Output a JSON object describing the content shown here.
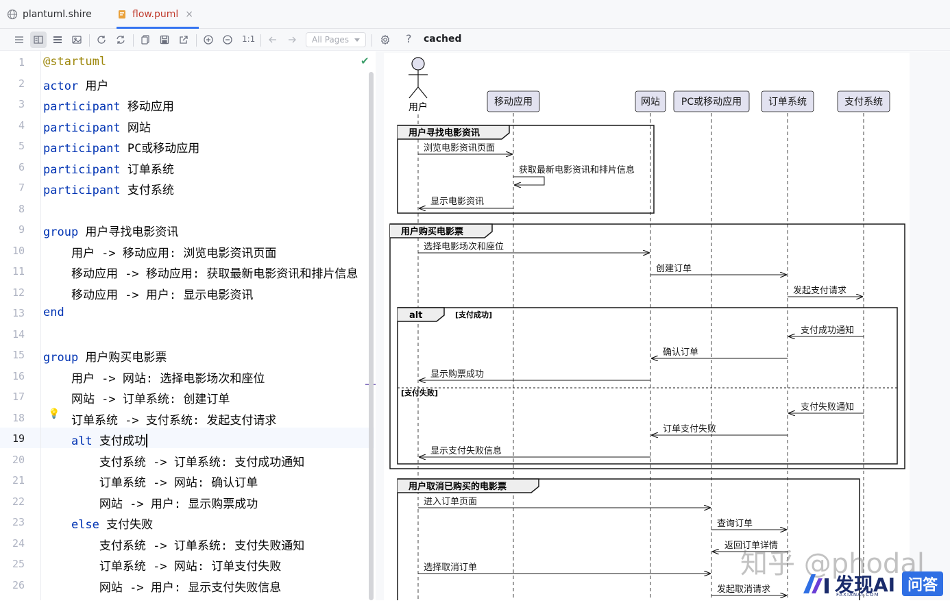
{
  "tabs": [
    {
      "label": "plantuml.shire",
      "icon": "globe-icon"
    },
    {
      "label": "flow.puml",
      "icon": "puml-file-icon",
      "close": "×"
    }
  ],
  "toolbar": {
    "zoom_label": "1:1",
    "pages_select": "All Pages",
    "help": "?",
    "status": "cached"
  },
  "editor": {
    "current_line": 19,
    "lines": [
      {
        "n": "1",
        "parts": [
          [
            "dir",
            "@startuml"
          ]
        ]
      },
      {
        "n": "2",
        "parts": [
          [
            "kw",
            "actor"
          ],
          [
            "t",
            " 用户"
          ]
        ]
      },
      {
        "n": "3",
        "parts": [
          [
            "kw",
            "participant"
          ],
          [
            "t",
            " 移动应用"
          ]
        ]
      },
      {
        "n": "4",
        "parts": [
          [
            "kw",
            "participant"
          ],
          [
            "t",
            " 网站"
          ]
        ]
      },
      {
        "n": "5",
        "parts": [
          [
            "kw",
            "participant"
          ],
          [
            "t",
            " PC或移动应用"
          ]
        ]
      },
      {
        "n": "6",
        "parts": [
          [
            "kw",
            "participant"
          ],
          [
            "t",
            " 订单系统"
          ]
        ]
      },
      {
        "n": "7",
        "parts": [
          [
            "kw",
            "participant"
          ],
          [
            "t",
            " 支付系统"
          ]
        ]
      },
      {
        "n": "8",
        "parts": []
      },
      {
        "n": "9",
        "parts": [
          [
            "kw",
            "group"
          ],
          [
            "t",
            " 用户寻找电影资讯"
          ]
        ]
      },
      {
        "n": "10",
        "parts": [
          [
            "t",
            "    用户 -> 移动应用: 浏览电影资讯页面"
          ]
        ]
      },
      {
        "n": "11",
        "parts": [
          [
            "t",
            "    移动应用 -> 移动应用: 获取最新电影资讯和排片信息"
          ]
        ]
      },
      {
        "n": "12",
        "parts": [
          [
            "t",
            "    移动应用 -> 用户: 显示电影资讯"
          ]
        ]
      },
      {
        "n": "13",
        "parts": [
          [
            "kw",
            "end"
          ]
        ]
      },
      {
        "n": "14",
        "parts": []
      },
      {
        "n": "15",
        "parts": [
          [
            "kw",
            "group"
          ],
          [
            "t",
            " 用户购买电影票"
          ]
        ]
      },
      {
        "n": "16",
        "parts": [
          [
            "t",
            "    用户 -> 网站: 选择电影场次和座位"
          ]
        ]
      },
      {
        "n": "17",
        "parts": [
          [
            "t",
            "    网站 -> 订单系统: 创建订单"
          ]
        ]
      },
      {
        "n": "18",
        "parts": [
          [
            "t",
            "    订单系统 -> 支付系统: 发起支付请求"
          ]
        ]
      },
      {
        "n": "19",
        "parts": [
          [
            "t",
            "    "
          ],
          [
            "kw",
            "alt"
          ],
          [
            "t",
            " 支付成功"
          ]
        ]
      },
      {
        "n": "20",
        "parts": [
          [
            "t",
            "        支付系统 -> 订单系统: 支付成功通知"
          ]
        ]
      },
      {
        "n": "21",
        "parts": [
          [
            "t",
            "        订单系统 -> 网站: 确认订单"
          ]
        ]
      },
      {
        "n": "22",
        "parts": [
          [
            "t",
            "        网站 -> 用户: 显示购票成功"
          ]
        ]
      },
      {
        "n": "23",
        "parts": [
          [
            "t",
            "    "
          ],
          [
            "kw",
            "else"
          ],
          [
            "t",
            " 支付失败"
          ]
        ]
      },
      {
        "n": "24",
        "parts": [
          [
            "t",
            "        支付系统 -> 订单系统: 支付失败通知"
          ]
        ]
      },
      {
        "n": "25",
        "parts": [
          [
            "t",
            "        订单系统 -> 网站: 订单支付失败"
          ]
        ]
      },
      {
        "n": "26",
        "parts": [
          [
            "t",
            "        网站 -> 用户: 显示支付失败信息"
          ]
        ]
      }
    ]
  },
  "diagram": {
    "actor": "用户",
    "participants": [
      "移动应用",
      "网站",
      "PC或移动应用",
      "订单系统",
      "支付系统"
    ],
    "groups": {
      "g1": "用户寻找电影资讯",
      "g2": "用户购买电影票",
      "alt": "alt",
      "alt_cond": "[支付成功]",
      "else_cond": "[支付失败]",
      "g3": "用户取消已购买的电影票"
    },
    "messages": {
      "m1": "浏览电影资讯页面",
      "m2": "获取最新电影资讯和排片信息",
      "m3": "显示电影资讯",
      "m4": "选择电影场次和座位",
      "m5": "创建订单",
      "m6": "发起支付请求",
      "m7": "支付成功通知",
      "m8": "确认订单",
      "m9": "显示购票成功",
      "m10": "支付失败通知",
      "m11": "订单支付失败",
      "m12": "显示支付失败信息",
      "m13": "进入订单页面",
      "m14": "查询订单",
      "m15": "返回订单详情",
      "m16": "选择取消订单",
      "m17": "发起取消请求"
    }
  },
  "watermark": {
    "text": "知乎 @phodal",
    "brand_main": "发现AI",
    "brand_sub": "FAXIANAI.COM",
    "brand_badge": "问答"
  }
}
